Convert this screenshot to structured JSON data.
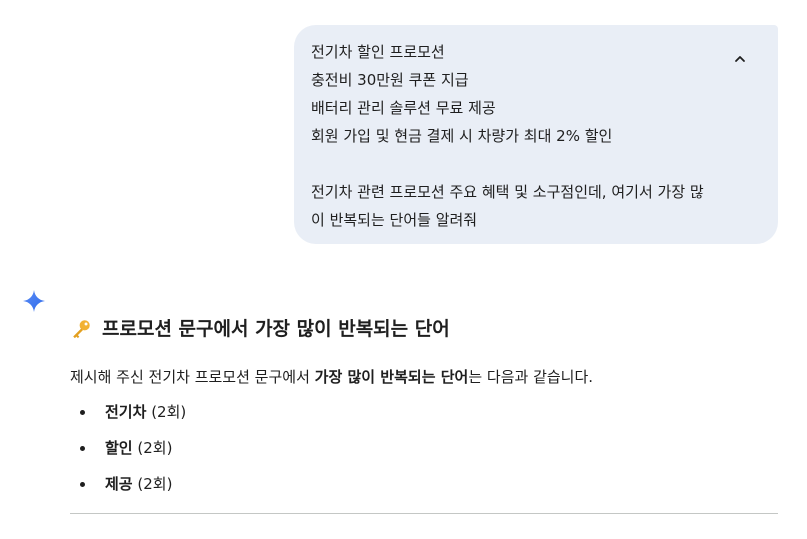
{
  "user_message": {
    "lines": [
      "전기차 할인 프로모션",
      "충전비 30만원 쿠폰 지급",
      "배터리 관리 솔루션 무료 제공",
      "회원 가입 및 현금 결제 시 차량가 최대 2% 할인",
      "",
      "전기차 관련 프로모션 주요 혜택 및 소구점인데, 여기서 가장 많",
      "이 반복되는 단어들 알려줘"
    ],
    "collapse_icon": "chevron-up-icon"
  },
  "response": {
    "avatar_icon": "gemini-sparkle-icon",
    "heading_icon": "key-icon",
    "heading": "프로모션 문구에서 가장 많이 반복되는 단어",
    "intro_before": "제시해 주신 전기차 프로모션 문구에서 ",
    "intro_bold": "가장 많이 반복되는 단어",
    "intro_after": "는 다음과 같습니다.",
    "items": [
      {
        "word": "전기차",
        "count": "(2회)"
      },
      {
        "word": "할인",
        "count": "(2회)"
      },
      {
        "word": "제공",
        "count": "(2회)"
      }
    ]
  },
  "colors": {
    "bubble_bg": "#e9eef6",
    "text": "#1f1f1f",
    "sparkle_blue": "#4285f4",
    "divider": "#c4c7c5"
  }
}
